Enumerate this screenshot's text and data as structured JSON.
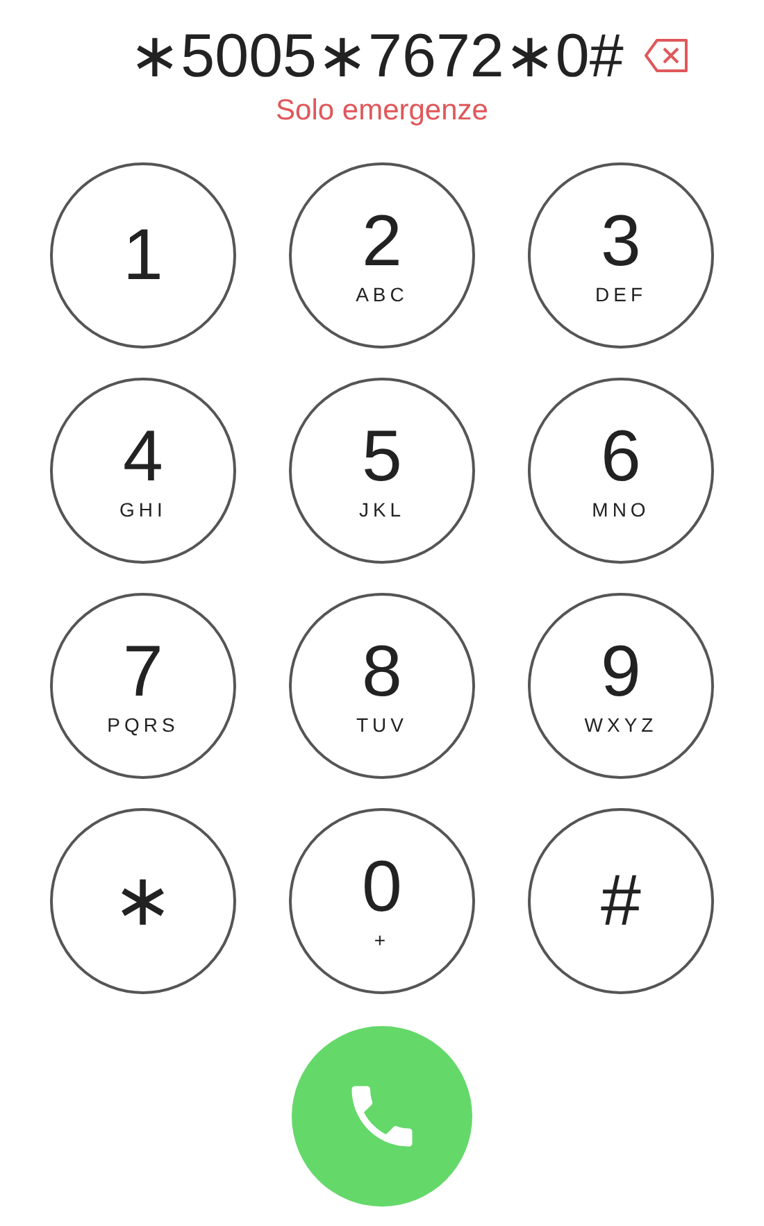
{
  "display": {
    "number": "∗5005∗7672∗0#",
    "notice": "Solo emergenze"
  },
  "keys": [
    {
      "digit": "1"
    },
    {
      "digit": "2",
      "letters": "ABC"
    },
    {
      "digit": "3",
      "letters": "DEF"
    },
    {
      "digit": "4",
      "letters": "GHI"
    },
    {
      "digit": "5",
      "letters": "JKL"
    },
    {
      "digit": "6",
      "letters": "MNO"
    },
    {
      "digit": "7",
      "letters": "PQRS"
    },
    {
      "digit": "8",
      "letters": "TUV"
    },
    {
      "digit": "9",
      "letters": "WXYZ"
    },
    {
      "digit": "∗"
    },
    {
      "digit": "0",
      "letters": "+"
    },
    {
      "digit": "#"
    }
  ]
}
